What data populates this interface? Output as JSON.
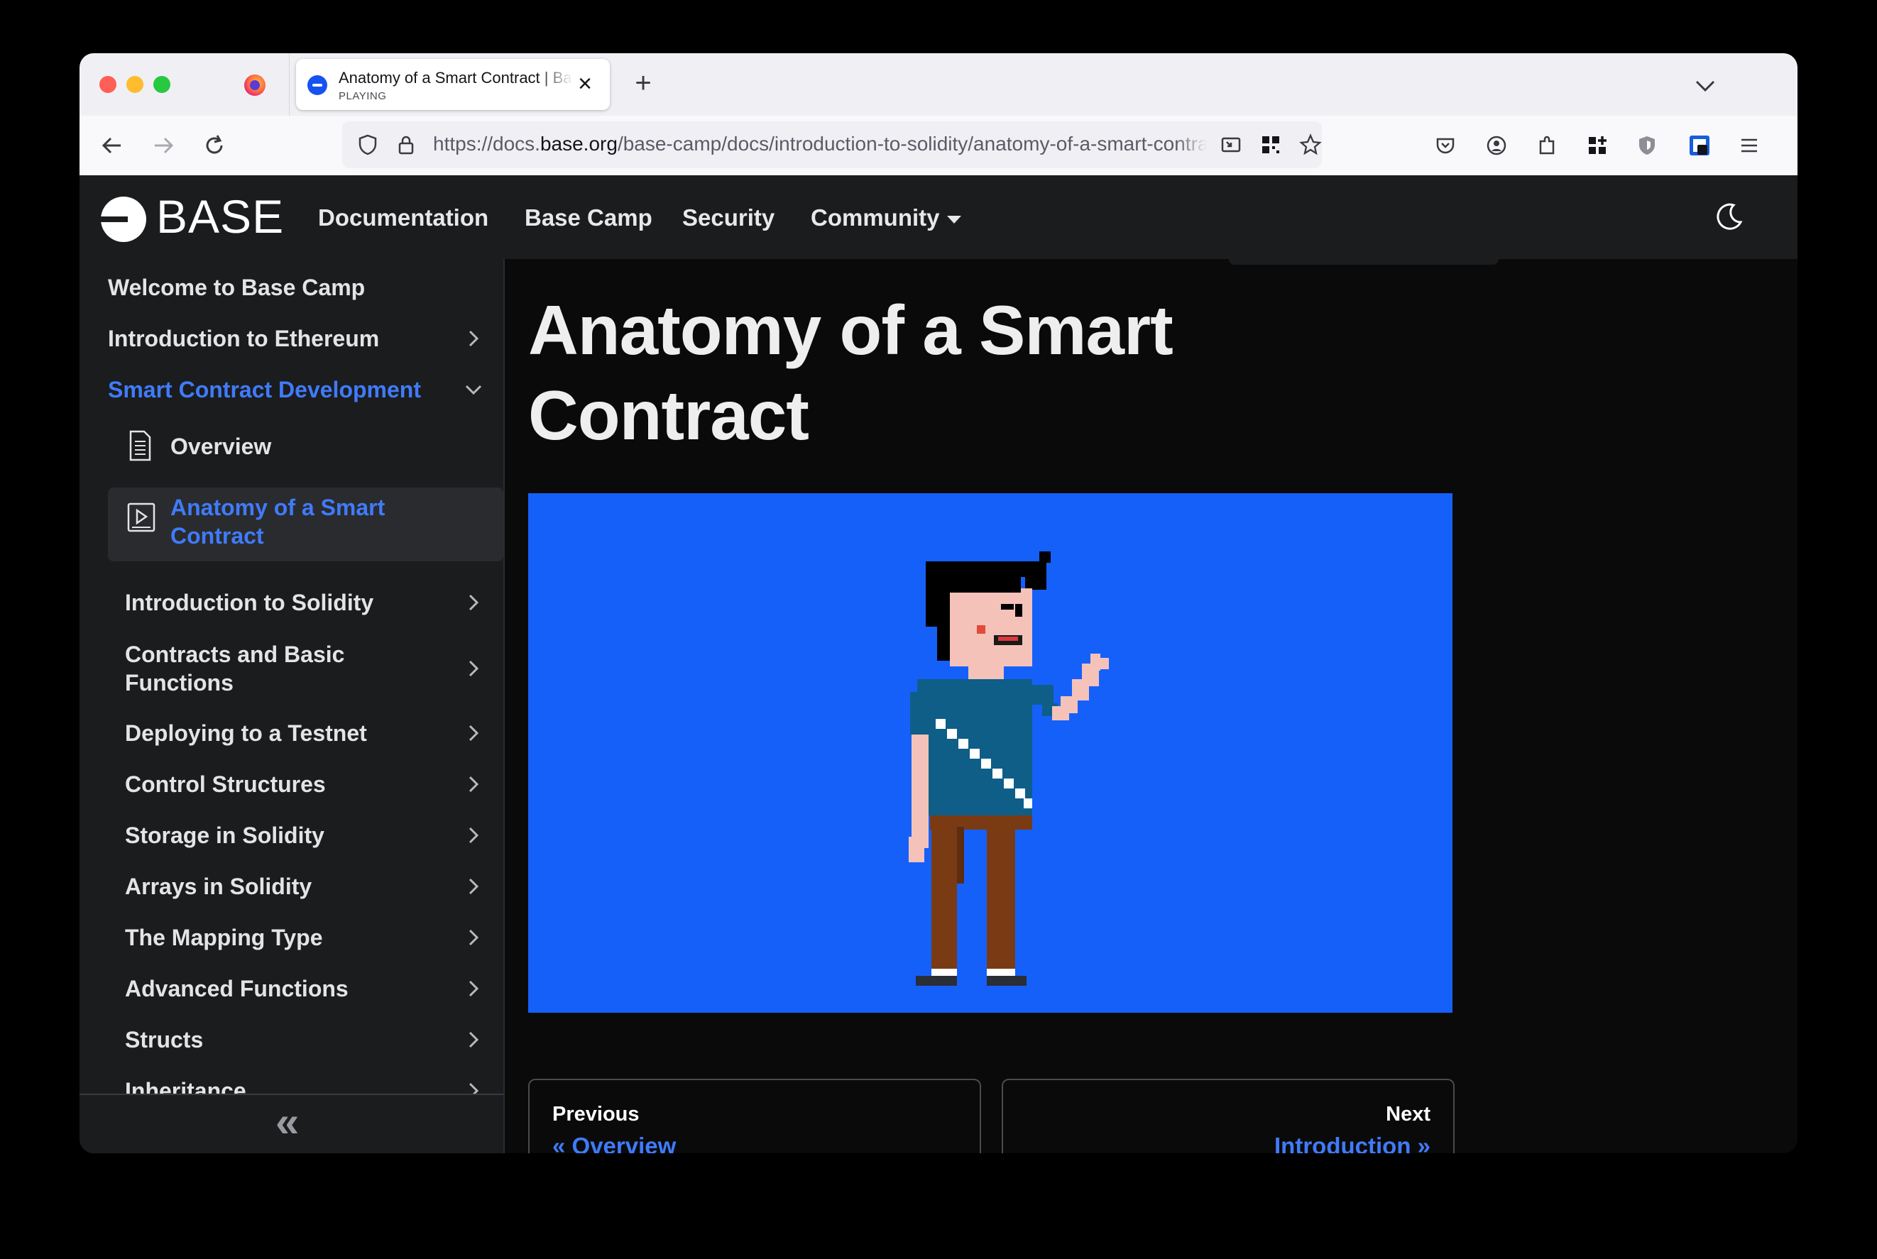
{
  "browser": {
    "tab": {
      "title": "Anatomy of a Smart Contract | Base",
      "status": "PLAYING"
    },
    "url": {
      "prefix": "https://docs.",
      "domain": "base.org",
      "path": "/base-camp/docs/introduction-to-solidity/anatomy-of-a-smart-contract"
    }
  },
  "site": {
    "logo_text": "BASE",
    "nav": [
      "Documentation",
      "Base Camp",
      "Security",
      "Community"
    ]
  },
  "sidebar": {
    "items": [
      {
        "label": "Welcome to Base Camp"
      },
      {
        "label": "Introduction to Ethereum"
      },
      {
        "label": "Smart Contract Development"
      },
      {
        "label": "Overview"
      },
      {
        "label": "Anatomy of a Smart Contract"
      },
      {
        "label": "Introduction to Solidity"
      },
      {
        "label": "Contracts and Basic Functions"
      },
      {
        "label": "Deploying to a Testnet"
      },
      {
        "label": "Control Structures"
      },
      {
        "label": "Storage in Solidity"
      },
      {
        "label": "Arrays in Solidity"
      },
      {
        "label": "The Mapping Type"
      },
      {
        "label": "Advanced Functions"
      },
      {
        "label": "Structs"
      },
      {
        "label": "Inheritance"
      }
    ],
    "collapse_icon": "«"
  },
  "main": {
    "title": "Anatomy of a Smart Contract",
    "pager": {
      "prev_label": "Previous",
      "prev_link": "« Overview",
      "next_label": "Next",
      "next_link": "Introduction »"
    }
  },
  "colors": {
    "accent": "#3f7bfa",
    "video_bg": "#1660fa",
    "header_bg": "#1b1c1e"
  }
}
